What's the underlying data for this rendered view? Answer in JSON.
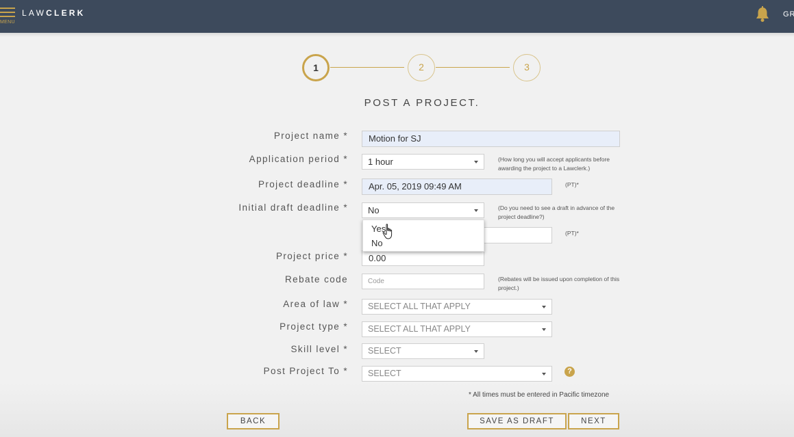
{
  "header": {
    "menu_label": "MENU",
    "logo_light": "LAW",
    "logo_bold": "CLERK",
    "user_initials": "GR",
    "bell_icon": "bell-icon",
    "menu_icon": "hamburger-icon"
  },
  "steps": [
    {
      "label": "1",
      "active": true
    },
    {
      "label": "2",
      "active": false
    },
    {
      "label": "3",
      "active": false
    }
  ],
  "title": "POST A PROJECT.",
  "form": {
    "project_name": {
      "label": "Project name *",
      "value": "Motion for SJ"
    },
    "application_period": {
      "label": "Application period *",
      "value": "1 hour",
      "hint": "(How long you will accept applicants before awarding the project to a Lawclerk.)"
    },
    "project_deadline": {
      "label": "Project deadline *",
      "value": "Apr. 05, 2019 09:49 AM",
      "hint": "(PT)*"
    },
    "initial_draft_deadline": {
      "label": "Initial draft deadline *",
      "value": "No",
      "hint": "(Do you need to see a draft in advance of the project deadline?)",
      "options": [
        "Yes",
        "No"
      ]
    },
    "draft_date_hint": "(PT)*",
    "project_price": {
      "label": "Project price *",
      "value": "0.00"
    },
    "rebate_code": {
      "label": "Rebate code",
      "placeholder": "Code",
      "hint": "(Rebates will be issued upon completion of this project.)"
    },
    "area_of_law": {
      "label": "Area of law *",
      "placeholder": "SELECT ALL THAT APPLY"
    },
    "project_type": {
      "label": "Project type *",
      "placeholder": "SELECT ALL THAT APPLY"
    },
    "skill_level": {
      "label": "Skill level *",
      "placeholder": "SELECT"
    },
    "post_project_to": {
      "label": "Post Project To *",
      "placeholder": "SELECT",
      "help_icon": "question-circle-icon"
    }
  },
  "note": "* All times must be entered in Pacific timezone",
  "buttons": {
    "back": "BACK",
    "save_draft": "SAVE AS DRAFT",
    "next": "NEXT"
  },
  "colors": {
    "header_bg": "#3d4a5c",
    "accent_gold": "#c9a44c",
    "filled_input_bg": "#e8eef9"
  }
}
